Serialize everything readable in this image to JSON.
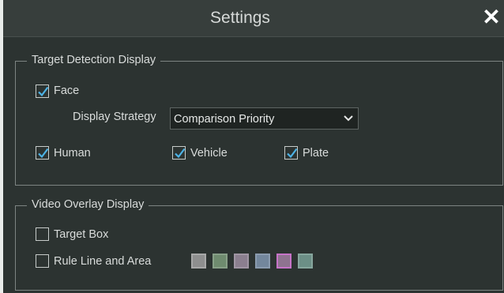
{
  "dialog": {
    "title": "Settings",
    "close_glyph": "✕"
  },
  "target_detection": {
    "legend": "Target Detection Display",
    "face": {
      "label": "Face",
      "checked": true
    },
    "display_strategy": {
      "label": "Display Strategy",
      "value": "Comparison Priority"
    },
    "human": {
      "label": "Human",
      "checked": true
    },
    "vehicle": {
      "label": "Vehicle",
      "checked": true
    },
    "plate": {
      "label": "Plate",
      "checked": true
    }
  },
  "video_overlay": {
    "legend": "Video Overlay Display",
    "target_box": {
      "label": "Target Box",
      "checked": false
    },
    "rule_line": {
      "label": "Rule Line and Area",
      "checked": false
    },
    "swatches": [
      {
        "name": "gray",
        "fill": "#8e8f8f",
        "border": "#a7a8a8"
      },
      {
        "name": "green",
        "fill": "#6f8b6f",
        "border": "#879f87"
      },
      {
        "name": "mauve",
        "fill": "#8b7f8f",
        "border": "#9f95a3"
      },
      {
        "name": "blue",
        "fill": "#73879c",
        "border": "#8a9bae"
      },
      {
        "name": "pink",
        "fill": "#8f7390",
        "border": "#c774c8"
      },
      {
        "name": "teal",
        "fill": "#6c8f86",
        "border": "#86a69d"
      }
    ]
  },
  "colors": {
    "check_accent": "#4db3e6",
    "background": "#2c3331",
    "titlebar": "#373e3c"
  }
}
